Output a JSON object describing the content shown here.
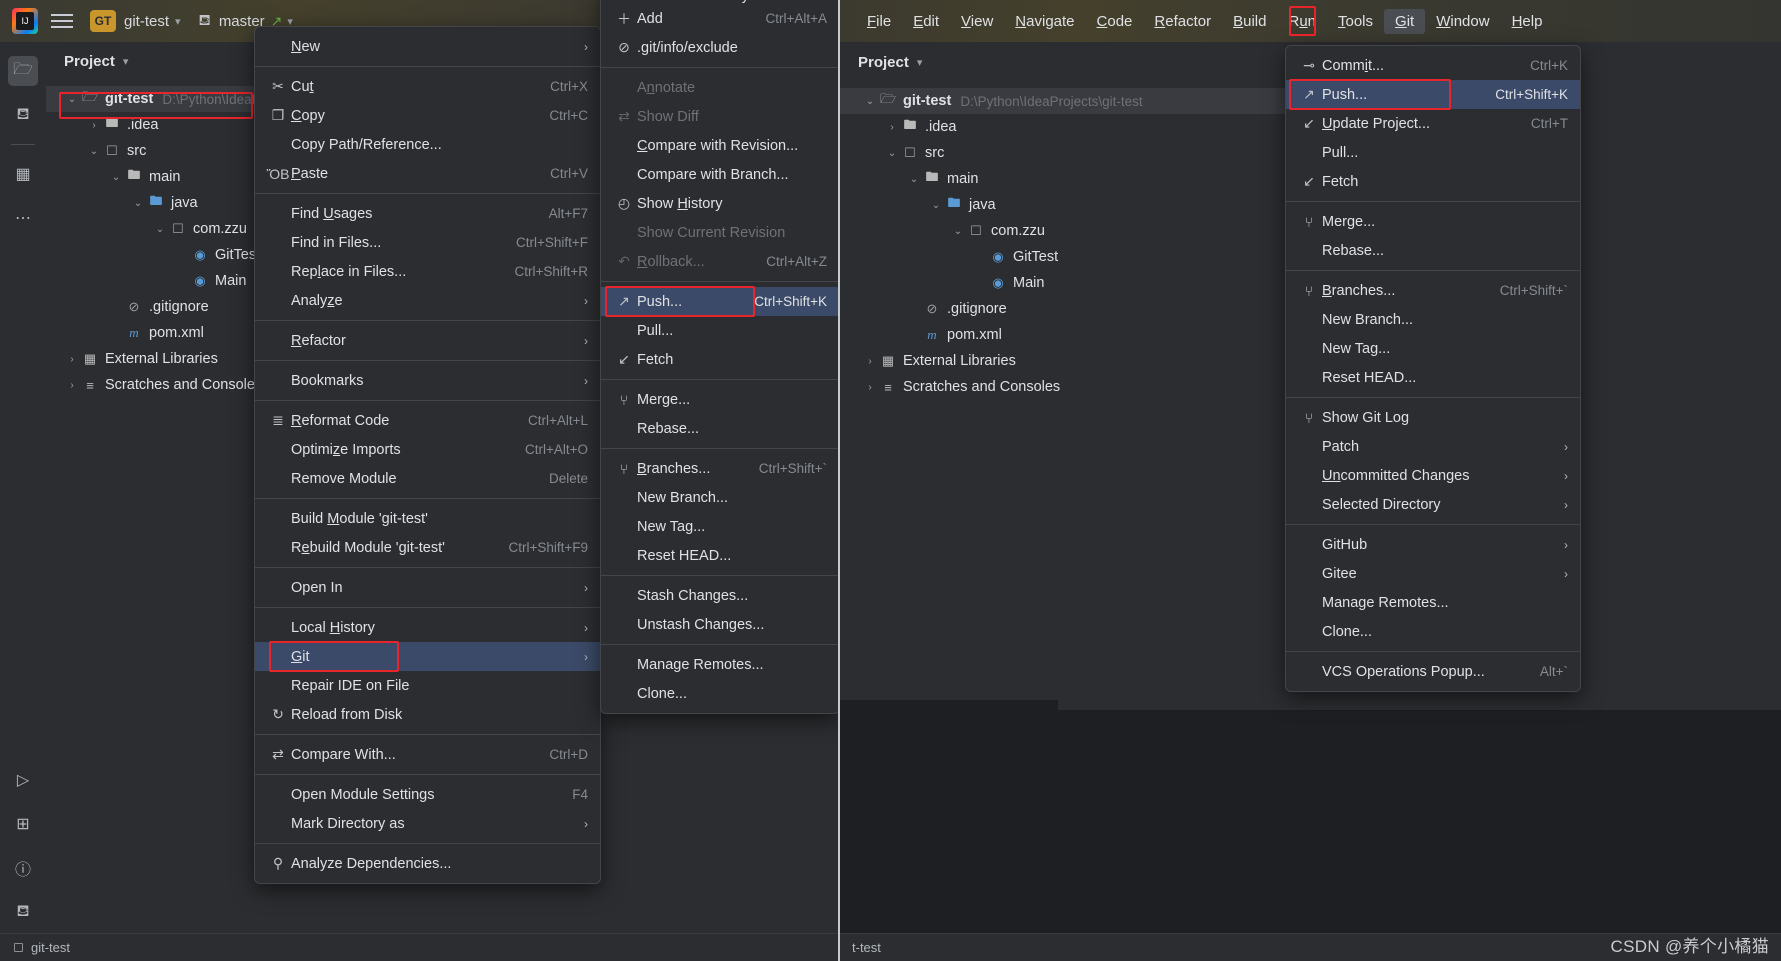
{
  "app": {
    "logo_label": "IJ",
    "project_badge": "GT",
    "project_name": "git-test",
    "branch_name": "master",
    "watermark": "CSDN @养个小橘猫"
  },
  "left_window": {
    "panel_title": "Project",
    "status_text": "git-test",
    "icon_strip": [
      {
        "name": "project-folder-icon",
        "glyph": "☐"
      },
      {
        "name": "commit-icon",
        "glyph": "⑂"
      },
      {
        "name": "structure-icon",
        "glyph": "⊞"
      },
      {
        "name": "more-icon",
        "glyph": "…"
      },
      {
        "name": "run-icon",
        "glyph": "▷"
      },
      {
        "name": "terminal-icon",
        "glyph": "⌸"
      },
      {
        "name": "problems-icon",
        "glyph": "ⓘ"
      },
      {
        "name": "git-branch-icon",
        "glyph": "⑂"
      }
    ],
    "tree": [
      {
        "indent": 0,
        "twist": "⌄",
        "icon": "module",
        "name": "git-test",
        "bold": true,
        "path": "D:\\Python\\IdeaP",
        "selected": true,
        "highlighted": true
      },
      {
        "indent": 1,
        "twist": "›",
        "icon": "folder",
        "name": ".idea",
        "bold": false,
        "path": ""
      },
      {
        "indent": 1,
        "twist": "⌄",
        "icon": "folder-src",
        "name": "src",
        "bold": false,
        "path": ""
      },
      {
        "indent": 2,
        "twist": "⌄",
        "icon": "folder",
        "name": "main",
        "bold": false,
        "path": ""
      },
      {
        "indent": 3,
        "twist": "⌄",
        "icon": "folder-blue",
        "name": "java",
        "bold": false,
        "path": ""
      },
      {
        "indent": 4,
        "twist": "⌄",
        "icon": "package",
        "name": "com.zzu",
        "bold": false,
        "path": ""
      },
      {
        "indent": 5,
        "twist": "",
        "icon": "class",
        "name": "GitTest",
        "bold": false,
        "path": ""
      },
      {
        "indent": 5,
        "twist": "",
        "icon": "class",
        "name": "Main",
        "bold": false,
        "path": ""
      },
      {
        "indent": 2,
        "twist": "",
        "icon": "ignore",
        "name": ".gitignore",
        "bold": false,
        "path": ""
      },
      {
        "indent": 2,
        "twist": "",
        "icon": "maven",
        "name": "pom.xml",
        "bold": false,
        "path": ""
      },
      {
        "indent": 0,
        "twist": "›",
        "icon": "libs",
        "name": "External Libraries",
        "bold": false,
        "path": ""
      },
      {
        "indent": 0,
        "twist": "›",
        "icon": "scratch",
        "name": "Scratches and Consoles",
        "bold": false,
        "path": ""
      }
    ]
  },
  "context_menu": {
    "items": [
      {
        "type": "item",
        "icon": "",
        "label": "New",
        "mnemonic": "N",
        "key": "",
        "submenu": true,
        "name": "menu-item-new"
      },
      {
        "type": "sep"
      },
      {
        "type": "item",
        "icon": "✂",
        "label": "Cut",
        "mnemonic": "t",
        "key": "Ctrl+X",
        "name": "menu-item-cut"
      },
      {
        "type": "item",
        "icon": "❐",
        "label": "Copy",
        "mnemonic": "C",
        "key": "Ctrl+C",
        "name": "menu-item-copy"
      },
      {
        "type": "item",
        "icon": "",
        "label": "Copy Path/Reference...",
        "mnemonic": "",
        "key": "",
        "name": "menu-item-copy-path"
      },
      {
        "type": "item",
        "icon": "ὌB",
        "label": "Paste",
        "mnemonic": "P",
        "key": "Ctrl+V",
        "name": "menu-item-paste"
      },
      {
        "type": "sep"
      },
      {
        "type": "item",
        "icon": "",
        "label": "Find Usages",
        "mnemonic": "U",
        "key": "Alt+F7",
        "name": "menu-item-find-usages"
      },
      {
        "type": "item",
        "icon": "",
        "label": "Find in Files...",
        "mnemonic": "",
        "key": "Ctrl+Shift+F",
        "name": "menu-item-find-in-files"
      },
      {
        "type": "item",
        "icon": "",
        "label": "Replace in Files...",
        "mnemonic": "l",
        "key": "Ctrl+Shift+R",
        "name": "menu-item-replace-in-files"
      },
      {
        "type": "item",
        "icon": "",
        "label": "Analyze",
        "mnemonic": "z",
        "key": "",
        "submenu": true,
        "name": "menu-item-analyze"
      },
      {
        "type": "sep"
      },
      {
        "type": "item",
        "icon": "",
        "label": "Refactor",
        "mnemonic": "R",
        "key": "",
        "submenu": true,
        "name": "menu-item-refactor"
      },
      {
        "type": "sep"
      },
      {
        "type": "item",
        "icon": "",
        "label": "Bookmarks",
        "mnemonic": "",
        "key": "",
        "submenu": true,
        "name": "menu-item-bookmarks"
      },
      {
        "type": "sep"
      },
      {
        "type": "item",
        "icon": "≣",
        "label": "Reformat Code",
        "mnemonic": "R",
        "key": "Ctrl+Alt+L",
        "name": "menu-item-reformat-code"
      },
      {
        "type": "item",
        "icon": "",
        "label": "Optimize Imports",
        "mnemonic": "z",
        "key": "Ctrl+Alt+O",
        "name": "menu-item-optimize-imports"
      },
      {
        "type": "item",
        "icon": "",
        "label": "Remove Module",
        "mnemonic": "",
        "key": "Delete",
        "name": "menu-item-remove-module"
      },
      {
        "type": "sep"
      },
      {
        "type": "item",
        "icon": "",
        "label": "Build Module 'git-test'",
        "mnemonic": "M",
        "key": "",
        "name": "menu-item-build-module"
      },
      {
        "type": "item",
        "icon": "",
        "label": "Rebuild Module 'git-test'",
        "mnemonic": "e",
        "key": "Ctrl+Shift+F9",
        "name": "menu-item-rebuild-module"
      },
      {
        "type": "sep"
      },
      {
        "type": "item",
        "icon": "",
        "label": "Open In",
        "mnemonic": "",
        "key": "",
        "submenu": true,
        "name": "menu-item-open-in"
      },
      {
        "type": "sep"
      },
      {
        "type": "item",
        "icon": "",
        "label": "Local History",
        "mnemonic": "H",
        "key": "",
        "submenu": true,
        "name": "menu-item-local-history"
      },
      {
        "type": "item",
        "icon": "",
        "label": "Git",
        "mnemonic": "G",
        "key": "",
        "submenu": true,
        "highlighted": true,
        "boxed": true,
        "name": "menu-item-git"
      },
      {
        "type": "item",
        "icon": "",
        "label": "Repair IDE on File",
        "mnemonic": "",
        "key": "",
        "name": "menu-item-repair-ide"
      },
      {
        "type": "item",
        "icon": "↻",
        "label": "Reload from Disk",
        "mnemonic": "",
        "key": "",
        "name": "menu-item-reload-from-disk"
      },
      {
        "type": "sep"
      },
      {
        "type": "item",
        "icon": "⇄",
        "label": "Compare With...",
        "mnemonic": "",
        "key": "Ctrl+D",
        "name": "menu-item-compare-with"
      },
      {
        "type": "sep"
      },
      {
        "type": "item",
        "icon": "",
        "label": "Open Module Settings",
        "mnemonic": "",
        "key": "F4",
        "name": "menu-item-open-module-settings"
      },
      {
        "type": "item",
        "icon": "",
        "label": "Mark Directory as",
        "mnemonic": "",
        "key": "",
        "submenu": true,
        "name": "menu-item-mark-directory-as"
      },
      {
        "type": "sep"
      },
      {
        "type": "item",
        "icon": "⚲",
        "label": "Analyze Dependencies...",
        "mnemonic": "",
        "key": "",
        "name": "menu-item-analyze-dependencies"
      }
    ]
  },
  "git_submenu": {
    "items": [
      {
        "type": "item",
        "icon": "",
        "label": "Commit Directory...",
        "key": "",
        "clipped": true,
        "name": "git-menu-commit-directory"
      },
      {
        "type": "item",
        "icon": "＋",
        "label": "Add",
        "key": "Ctrl+Alt+A",
        "name": "git-menu-add"
      },
      {
        "type": "item",
        "icon": "⊘",
        "label": ".git/info/exclude",
        "key": "",
        "name": "git-menu-git-exclude"
      },
      {
        "type": "sep"
      },
      {
        "type": "item",
        "icon": "",
        "label": "Annotate",
        "key": "",
        "disabled": true,
        "mnemonic": "n",
        "name": "git-menu-annotate"
      },
      {
        "type": "item",
        "icon": "⇄",
        "label": "Show Diff",
        "key": "",
        "disabled": true,
        "name": "git-menu-show-diff"
      },
      {
        "type": "item",
        "icon": "",
        "label": "Compare with Revision...",
        "key": "",
        "mnemonic": "C",
        "name": "git-menu-compare-with-revision"
      },
      {
        "type": "item",
        "icon": "",
        "label": "Compare with Branch...",
        "key": "",
        "name": "git-menu-compare-with-branch"
      },
      {
        "type": "item",
        "icon": "◴",
        "label": "Show History",
        "key": "",
        "mnemonic": "H",
        "name": "git-menu-show-history"
      },
      {
        "type": "item",
        "icon": "",
        "label": "Show Current Revision",
        "key": "",
        "disabled": true,
        "name": "git-menu-show-current-revision"
      },
      {
        "type": "item",
        "icon": "↶",
        "label": "Rollback...",
        "key": "Ctrl+Alt+Z",
        "disabled": true,
        "mnemonic": "R",
        "name": "git-menu-rollback"
      },
      {
        "type": "sep"
      },
      {
        "type": "item",
        "icon": "↗",
        "label": "Push...",
        "key": "Ctrl+Shift+K",
        "highlighted": true,
        "boxed": true,
        "name": "git-menu-push"
      },
      {
        "type": "item",
        "icon": "",
        "label": "Pull...",
        "key": "",
        "name": "git-menu-pull"
      },
      {
        "type": "item",
        "icon": "↙",
        "label": "Fetch",
        "key": "",
        "name": "git-menu-fetch"
      },
      {
        "type": "sep"
      },
      {
        "type": "item",
        "icon": "⑂",
        "label": "Merge...",
        "key": "",
        "name": "git-menu-merge"
      },
      {
        "type": "item",
        "icon": "",
        "label": "Rebase...",
        "key": "",
        "name": "git-menu-rebase"
      },
      {
        "type": "sep"
      },
      {
        "type": "item",
        "icon": "⑂",
        "label": "Branches...",
        "key": "Ctrl+Shift+`",
        "mnemonic": "B",
        "name": "git-menu-branches"
      },
      {
        "type": "item",
        "icon": "",
        "label": "New Branch...",
        "key": "",
        "name": "git-menu-new-branch"
      },
      {
        "type": "item",
        "icon": "",
        "label": "New Tag...",
        "key": "",
        "name": "git-menu-new-tag"
      },
      {
        "type": "item",
        "icon": "",
        "label": "Reset HEAD...",
        "key": "",
        "name": "git-menu-reset-head"
      },
      {
        "type": "sep"
      },
      {
        "type": "item",
        "icon": "",
        "label": "Stash Changes...",
        "key": "",
        "name": "git-menu-stash-changes"
      },
      {
        "type": "item",
        "icon": "",
        "label": "Unstash Changes...",
        "key": "",
        "name": "git-menu-unstash-changes"
      },
      {
        "type": "sep"
      },
      {
        "type": "item",
        "icon": "",
        "label": "Manage Remotes...",
        "key": "",
        "name": "git-menu-manage-remotes"
      },
      {
        "type": "item",
        "icon": "",
        "label": "Clone...",
        "key": "",
        "name": "git-menu-clone"
      }
    ]
  },
  "right_window": {
    "menubar": [
      {
        "label": "File",
        "mnemonic": "F",
        "name": "menubar-file"
      },
      {
        "label": "Edit",
        "mnemonic": "E",
        "name": "menubar-edit"
      },
      {
        "label": "View",
        "mnemonic": "V",
        "name": "menubar-view"
      },
      {
        "label": "Navigate",
        "mnemonic": "N",
        "name": "menubar-navigate"
      },
      {
        "label": "Code",
        "mnemonic": "C",
        "name": "menubar-code"
      },
      {
        "label": "Refactor",
        "mnemonic": "R",
        "name": "menubar-refactor"
      },
      {
        "label": "Build",
        "mnemonic": "B",
        "name": "menubar-build"
      },
      {
        "label": "Run",
        "mnemonic": "u",
        "name": "menubar-run"
      },
      {
        "label": "Tools",
        "mnemonic": "T",
        "name": "menubar-tools"
      },
      {
        "label": "Git",
        "mnemonic": "G",
        "active": true,
        "boxed": true,
        "name": "menubar-git"
      },
      {
        "label": "Window",
        "mnemonic": "W",
        "name": "menubar-window"
      },
      {
        "label": "Help",
        "mnemonic": "H",
        "name": "menubar-help"
      }
    ],
    "panel_title": "Project",
    "status_text": "t-test",
    "tree": [
      {
        "indent": 0,
        "twist": "⌄",
        "icon": "module",
        "name": "git-test",
        "bold": true,
        "path": "D:\\Python\\IdeaProjects\\git-test",
        "selected": true
      },
      {
        "indent": 1,
        "twist": "›",
        "icon": "folder",
        "name": ".idea",
        "bold": false,
        "path": ""
      },
      {
        "indent": 1,
        "twist": "⌄",
        "icon": "folder-src",
        "name": "src",
        "bold": false,
        "path": ""
      },
      {
        "indent": 2,
        "twist": "⌄",
        "icon": "folder",
        "name": "main",
        "bold": false,
        "path": ""
      },
      {
        "indent": 3,
        "twist": "⌄",
        "icon": "folder-blue",
        "name": "java",
        "bold": false,
        "path": ""
      },
      {
        "indent": 4,
        "twist": "⌄",
        "icon": "package",
        "name": "com.zzu",
        "bold": false,
        "path": ""
      },
      {
        "indent": 5,
        "twist": "",
        "icon": "class",
        "name": "GitTest",
        "bold": false,
        "path": ""
      },
      {
        "indent": 5,
        "twist": "",
        "icon": "class",
        "name": "Main",
        "bold": false,
        "path": ""
      },
      {
        "indent": 2,
        "twist": "",
        "icon": "ignore",
        "name": ".gitignore",
        "bold": false,
        "path": ""
      },
      {
        "indent": 2,
        "twist": "",
        "icon": "maven",
        "name": "pom.xml",
        "bold": false,
        "path": ""
      },
      {
        "indent": 0,
        "twist": "›",
        "icon": "libs",
        "name": "External Libraries",
        "bold": false,
        "path": ""
      },
      {
        "indent": 0,
        "twist": "›",
        "icon": "scratch",
        "name": "Scratches and Consoles",
        "bold": false,
        "path": ""
      }
    ]
  },
  "git_menubar_menu": {
    "items": [
      {
        "type": "item",
        "icon": "⊸",
        "label": "Commit...",
        "key": "Ctrl+K",
        "mnemonic": "i",
        "name": "gitmenu-commit"
      },
      {
        "type": "item",
        "icon": "↗",
        "label": "Push...",
        "key": "Ctrl+Shift+K",
        "highlighted": true,
        "boxed": true,
        "name": "gitmenu-push"
      },
      {
        "type": "item",
        "icon": "↙",
        "label": "Update Project...",
        "key": "Ctrl+T",
        "mnemonic": "U",
        "name": "gitmenu-update-project"
      },
      {
        "type": "item",
        "icon": "",
        "label": "Pull...",
        "key": "",
        "name": "gitmenu-pull"
      },
      {
        "type": "item",
        "icon": "↙",
        "label": "Fetch",
        "key": "",
        "name": "gitmenu-fetch"
      },
      {
        "type": "sep"
      },
      {
        "type": "item",
        "icon": "⑂",
        "label": "Merge...",
        "key": "",
        "name": "gitmenu-merge"
      },
      {
        "type": "item",
        "icon": "",
        "label": "Rebase...",
        "key": "",
        "name": "gitmenu-rebase"
      },
      {
        "type": "sep"
      },
      {
        "type": "item",
        "icon": "⑂",
        "label": "Branches...",
        "key": "Ctrl+Shift+`",
        "mnemonic": "B",
        "name": "gitmenu-branches"
      },
      {
        "type": "item",
        "icon": "",
        "label": "New Branch...",
        "key": "",
        "name": "gitmenu-new-branch"
      },
      {
        "type": "item",
        "icon": "",
        "label": "New Tag...",
        "key": "",
        "name": "gitmenu-new-tag"
      },
      {
        "type": "item",
        "icon": "",
        "label": "Reset HEAD...",
        "key": "",
        "name": "gitmenu-reset-head"
      },
      {
        "type": "sep"
      },
      {
        "type": "item",
        "icon": "⑂",
        "label": "Show Git Log",
        "key": "",
        "name": "gitmenu-show-git-log"
      },
      {
        "type": "item",
        "icon": "",
        "label": "Patch",
        "key": "",
        "submenu": true,
        "name": "gitmenu-patch"
      },
      {
        "type": "item",
        "icon": "",
        "label": "Uncommitted Changes",
        "key": "",
        "submenu": true,
        "mnemonic": "Un",
        "name": "gitmenu-uncommitted-changes"
      },
      {
        "type": "item",
        "icon": "",
        "label": "Selected Directory",
        "key": "",
        "submenu": true,
        "name": "gitmenu-selected-directory"
      },
      {
        "type": "sep"
      },
      {
        "type": "item",
        "icon": "",
        "label": "GitHub",
        "key": "",
        "submenu": true,
        "name": "gitmenu-github"
      },
      {
        "type": "item",
        "icon": "",
        "label": "Gitee",
        "key": "",
        "submenu": true,
        "name": "gitmenu-gitee"
      },
      {
        "type": "item",
        "icon": "",
        "label": "Manage Remotes...",
        "key": "",
        "name": "gitmenu-manage-remotes"
      },
      {
        "type": "item",
        "icon": "",
        "label": "Clone...",
        "key": "",
        "name": "gitmenu-clone"
      },
      {
        "type": "sep"
      },
      {
        "type": "item",
        "icon": "",
        "label": "VCS Operations Popup...",
        "key": "Alt+`",
        "name": "gitmenu-vcs-operations-popup"
      }
    ]
  },
  "colors": {
    "accent_highlight": "#3b4a68",
    "annotation_red": "#e8252a",
    "panel_bg": "#2b2d30",
    "editor_bg": "#1e1f22"
  }
}
